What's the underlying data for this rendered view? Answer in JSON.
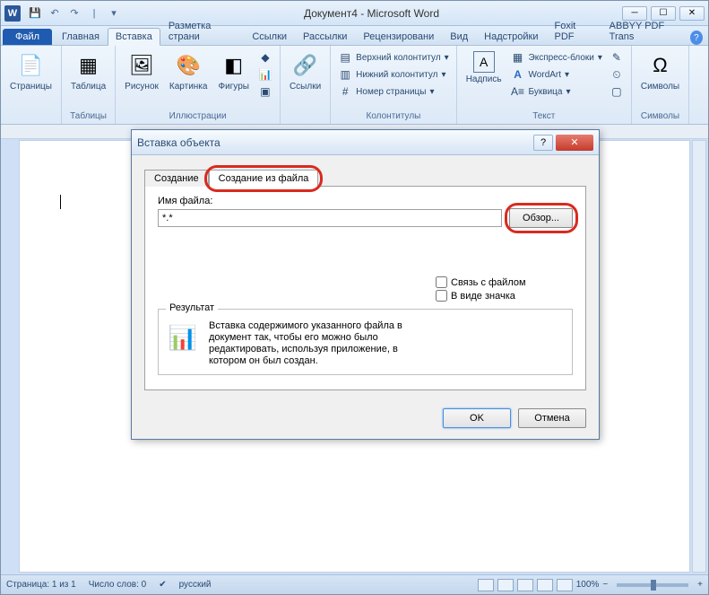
{
  "window": {
    "title": "Документ4 - Microsoft Word",
    "word_logo": "W"
  },
  "tabs": {
    "file": "Файл",
    "items": [
      "Главная",
      "Вставка",
      "Разметка страни",
      "Ссылки",
      "Рассылки",
      "Рецензировани",
      "Вид",
      "Надстройки",
      "Foxit PDF",
      "ABBYY PDF Trans"
    ],
    "active_index": 1
  },
  "ribbon": {
    "groups": {
      "pages": {
        "label": "",
        "buttons": {
          "pages": "Страницы"
        }
      },
      "tables": {
        "label": "Таблицы",
        "buttons": {
          "table": "Таблица"
        }
      },
      "illustrations": {
        "label": "Иллюстрации",
        "buttons": {
          "picture": "Рисунок",
          "clipart": "Картинка",
          "shapes": "Фигуры"
        }
      },
      "links": {
        "label": "",
        "buttons": {
          "links": "Ссылки"
        }
      },
      "header_footer": {
        "label": "Колонтитулы",
        "buttons": {
          "header": "Верхний колонтитул",
          "footer": "Нижний колонтитул",
          "page_number": "Номер страницы"
        }
      },
      "text": {
        "label": "Текст",
        "buttons": {
          "textbox": "Надпись",
          "quickparts": "Экспресс-блоки",
          "wordart": "WordArt",
          "dropcap": "Буквица"
        }
      },
      "symbols": {
        "label": "Символы",
        "buttons": {
          "symbols": "Символы"
        }
      }
    }
  },
  "dialog": {
    "title": "Вставка объекта",
    "tabs": {
      "create": "Создание",
      "from_file": "Создание из файла"
    },
    "filename_label": "Имя файла:",
    "filename_value": "*.*",
    "browse": "Обзор...",
    "link_to_file": "Связь с файлом",
    "as_icon": "В виде значка",
    "result_label": "Результат",
    "result_text": "Вставка содержимого указанного файла в документ так, чтобы его можно было редактировать, используя приложение, в котором он был создан.",
    "ok": "OK",
    "cancel": "Отмена"
  },
  "statusbar": {
    "page": "Страница: 1 из 1",
    "words": "Число слов: 0",
    "language": "русский",
    "zoom": "100%"
  }
}
